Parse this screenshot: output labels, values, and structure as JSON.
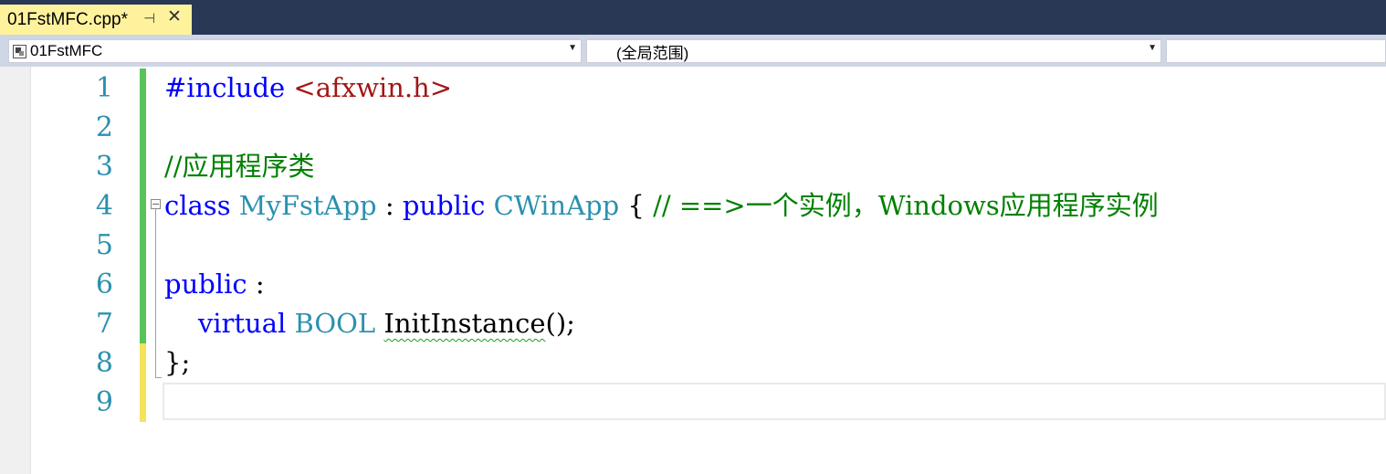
{
  "tab": {
    "title": "01FstMFC.cpp*",
    "pin_icon": "pin-icon",
    "close_icon": "close-icon"
  },
  "nav": {
    "project": "01FstMFC",
    "scope": "(全局范围)",
    "member": ""
  },
  "editor": {
    "line_numbers": [
      "1",
      "2",
      "3",
      "4",
      "5",
      "6",
      "7",
      "8",
      "9"
    ],
    "code": {
      "l1_pp": "#include ",
      "l1_str": "<afxwin.h>",
      "l3_comment": "//应用程序类",
      "l4_class": "class",
      "l4_name": " MyFstApp",
      "l4_colon": " : ",
      "l4_public": "public",
      "l4_base": " CWinApp",
      "l4_brace": " { ",
      "l4_comment": "// ==>一个实例，Windows应用程序实例",
      "l6_public": "public",
      "l6_colon": " :",
      "l7_indent": "    ",
      "l7_virtual": "virtual",
      "l7_bool": " BOOL",
      "l7_space": " ",
      "l7_func": "InitInstance",
      "l7_rest": "();",
      "l8_close": "};"
    },
    "colors": {
      "keyword": "#0000ff",
      "type": "#2b91af",
      "comment": "#008000",
      "string": "#a31515",
      "saved_change": "#57c35a",
      "unsaved_change": "#f5e35a"
    }
  }
}
